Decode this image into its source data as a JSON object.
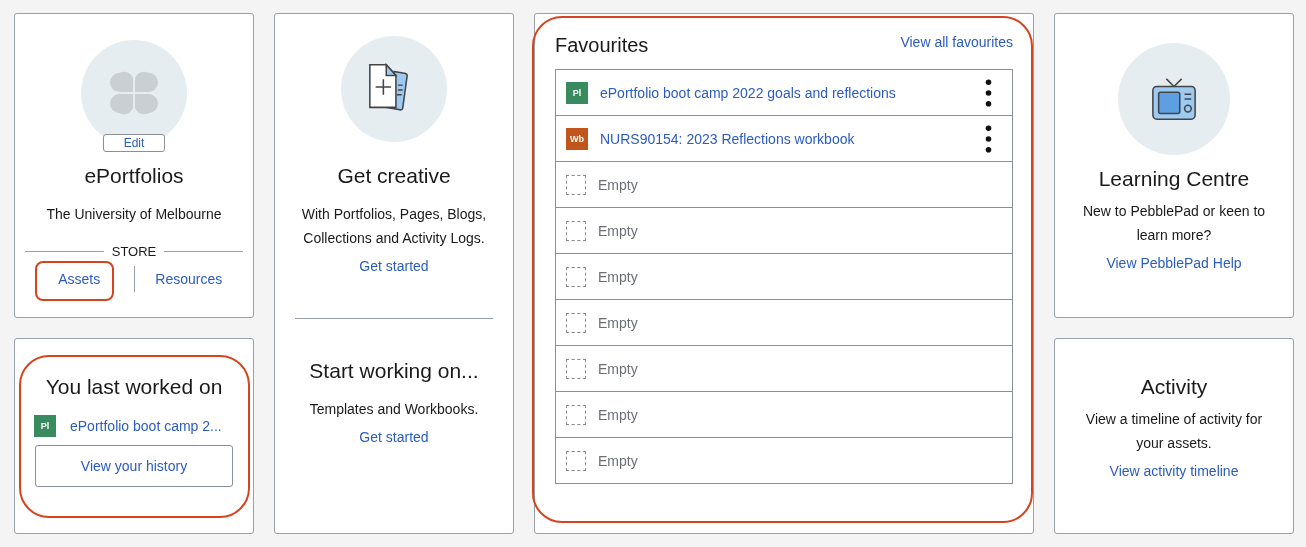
{
  "profile": {
    "edit_label": "Edit",
    "title": "ePortfolios",
    "subtitle": "The University of Melbourne",
    "store_heading": "STORE",
    "store_links": [
      {
        "label": "Assets",
        "highlighted": true
      },
      {
        "label": "Resources",
        "highlighted": false
      }
    ]
  },
  "last_worked": {
    "highlighted": true,
    "title": "You last worked on",
    "item": {
      "badge": "Pl",
      "color": "#3a8a5f",
      "title": "ePortfolio boot camp 2..."
    },
    "button": "View your history"
  },
  "create": {
    "sections": [
      {
        "title": "Get creative",
        "text": "With Portfolios, Pages, Blogs, Collections and Activity Logs.",
        "link": "Get started"
      },
      {
        "title": "Start working on...",
        "text": "Templates and Workbooks.",
        "link": "Get started"
      }
    ]
  },
  "favourites": {
    "highlighted": true,
    "title": "Favourites",
    "link": "View all favourites",
    "items": [
      {
        "kind": "asset",
        "badge": "Pl",
        "color": "#3a8a5f",
        "title": "ePortfolio boot camp 2022 goals and reflections"
      },
      {
        "kind": "asset",
        "badge": "Wb",
        "color": "#c0561c",
        "title": "NURS90154: 2023 Reflections workbook"
      },
      {
        "kind": "empty",
        "title": "Empty"
      },
      {
        "kind": "empty",
        "title": "Empty"
      },
      {
        "kind": "empty",
        "title": "Empty"
      },
      {
        "kind": "empty",
        "title": "Empty"
      },
      {
        "kind": "empty",
        "title": "Empty"
      },
      {
        "kind": "empty",
        "title": "Empty"
      },
      {
        "kind": "empty",
        "title": "Empty"
      }
    ]
  },
  "learning": {
    "title": "Learning Centre",
    "text": "New to PebblePad or keen to learn more?",
    "link": "View PebblePad Help"
  },
  "activity": {
    "title": "Activity",
    "text": "View a timeline of activity for your assets.",
    "link": "View activity timeline"
  }
}
